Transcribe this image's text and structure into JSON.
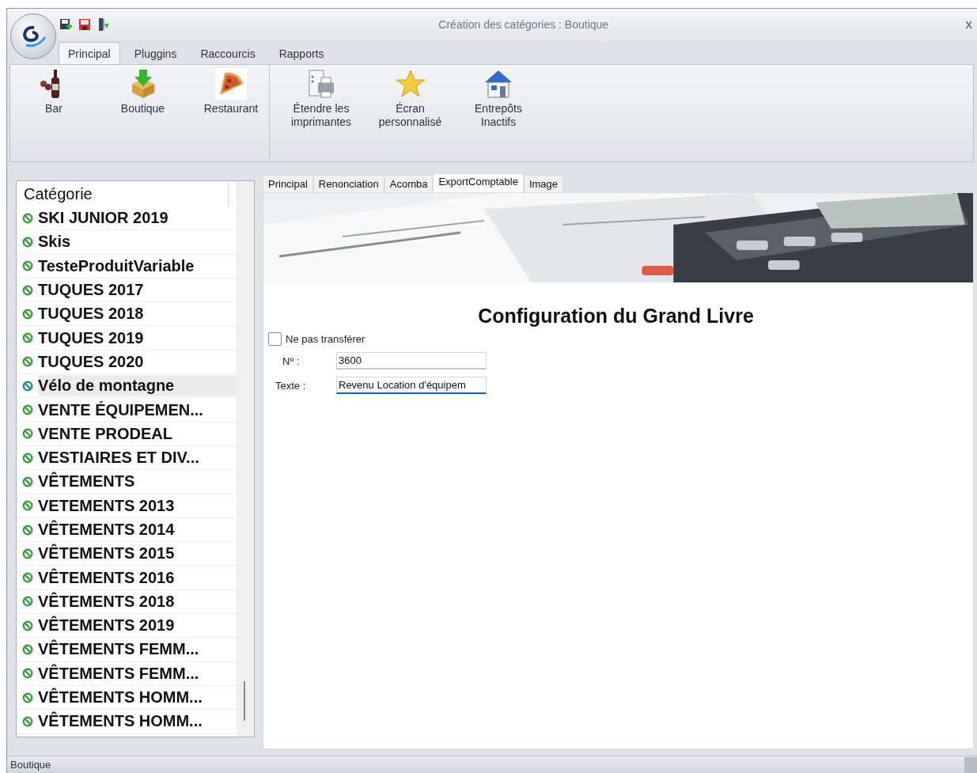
{
  "window": {
    "title": "Création des catégories : Boutique",
    "close": "x"
  },
  "ribbon_tabs": [
    {
      "label": "Principal",
      "selected": true
    },
    {
      "label": "Pluggins",
      "selected": false
    },
    {
      "label": "Raccourcis",
      "selected": false
    },
    {
      "label": "Rapports",
      "selected": false
    }
  ],
  "ribbon_groups": [
    [
      {
        "label": "Bar",
        "kind": "bar"
      },
      {
        "label": "Boutique",
        "kind": "box"
      },
      {
        "label": "Restaurant",
        "kind": "pizza"
      }
    ],
    [
      {
        "label": "Étendre les\nimprimantes",
        "kind": "printer"
      },
      {
        "label": "Écran\npersonnalisé",
        "kind": "star"
      },
      {
        "label": "Entrepôts\nInactifs",
        "kind": "house"
      }
    ]
  ],
  "category_list": {
    "header": "Catégorie",
    "items": [
      {
        "label": "SKI JUNIOR 2019",
        "selected": false
      },
      {
        "label": "Skis",
        "selected": false
      },
      {
        "label": "TesteProduitVariable",
        "selected": false
      },
      {
        "label": "TUQUES 2017",
        "selected": false
      },
      {
        "label": "TUQUES 2018",
        "selected": false
      },
      {
        "label": "TUQUES 2019",
        "selected": false
      },
      {
        "label": "TUQUES 2020",
        "selected": false
      },
      {
        "label": "Vélo de montagne",
        "selected": true
      },
      {
        "label": "VENTE ÉQUIPEMEN...",
        "selected": false
      },
      {
        "label": "VENTE PRODEAL",
        "selected": false
      },
      {
        "label": "VESTIAIRES ET DIV...",
        "selected": false
      },
      {
        "label": "VÊTEMENTS",
        "selected": false
      },
      {
        "label": "VETEMENTS 2013",
        "selected": false
      },
      {
        "label": "VÊTEMENTS 2014",
        "selected": false
      },
      {
        "label": "VÊTEMENTS 2015",
        "selected": false
      },
      {
        "label": "VÊTEMENTS 2016",
        "selected": false
      },
      {
        "label": "VÊTEMENTS 2018",
        "selected": false
      },
      {
        "label": "VÊTEMENTS 2019",
        "selected": false
      },
      {
        "label": "VÊTEMENTS FEMM...",
        "selected": false
      },
      {
        "label": "VÊTEMENTS FEMM...",
        "selected": false
      },
      {
        "label": "VÊTEMENTS HOMM...",
        "selected": false
      },
      {
        "label": "VÊTEMENTS HOMM...",
        "selected": false
      }
    ]
  },
  "detail_tabs": [
    {
      "label": "Principal",
      "selected": false
    },
    {
      "label": "Renonciation",
      "selected": false
    },
    {
      "label": "Acomba",
      "selected": false
    },
    {
      "label": "ExportComptable",
      "selected": true
    },
    {
      "label": "Image",
      "selected": false
    }
  ],
  "banner": {
    "kind": "picture"
  },
  "form": {
    "heading": "Configuration du Grand Livre",
    "no_transfer": {
      "label": "Ne pas transférer",
      "checked": false
    },
    "fields": [
      {
        "label": "Nº :",
        "value": "3600",
        "focused": false
      },
      {
        "label": "Texte :",
        "value": "Revenu Location d'équipem",
        "focused": true
      }
    ]
  },
  "status_bar": {
    "text": "Boutique"
  }
}
